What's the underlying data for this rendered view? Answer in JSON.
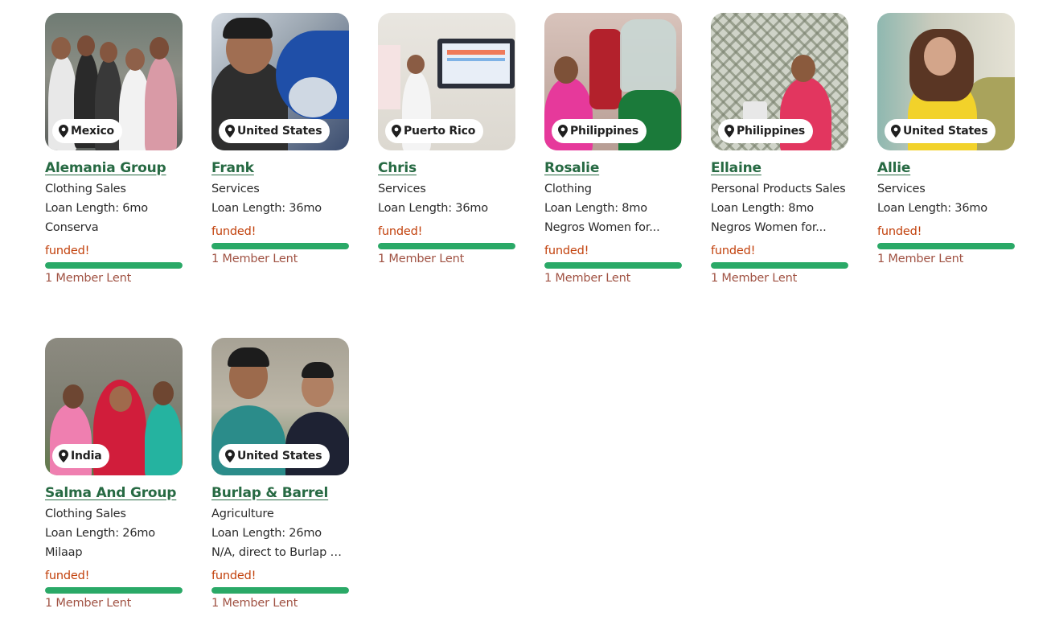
{
  "loans": [
    {
      "name": "Alemania Group",
      "country": "Mexico",
      "sector": "Clothing Sales",
      "loan_length": "Loan Length: 6mo",
      "partner": "Conserva",
      "status": "funded!",
      "progress": 1.0,
      "lenders": "1 Member Lent",
      "icon": "map-pin-icon"
    },
    {
      "name": "Frank",
      "country": "United States",
      "sector": "Services",
      "loan_length": "Loan Length: 36mo",
      "partner": "",
      "status": "funded!",
      "progress": 1.0,
      "lenders": "1 Member Lent",
      "icon": "map-pin-icon"
    },
    {
      "name": "Chris",
      "country": "Puerto Rico",
      "sector": "Services",
      "loan_length": "Loan Length: 36mo",
      "partner": "",
      "status": "funded!",
      "progress": 1.0,
      "lenders": "1 Member Lent",
      "icon": "map-pin-icon"
    },
    {
      "name": "Rosalie",
      "country": "Philippines",
      "sector": "Clothing",
      "loan_length": "Loan Length: 8mo",
      "partner": "Negros Women for...",
      "status": "funded!",
      "progress": 1.0,
      "lenders": "1 Member Lent",
      "icon": "map-pin-icon"
    },
    {
      "name": "Ellaine",
      "country": "Philippines",
      "sector": "Personal Products Sales",
      "loan_length": "Loan Length: 8mo",
      "partner": "Negros Women for...",
      "status": "funded!",
      "progress": 1.0,
      "lenders": "1 Member Lent",
      "icon": "map-pin-icon"
    },
    {
      "name": "Allie",
      "country": "United States",
      "sector": "Services",
      "loan_length": "Loan Length: 36mo",
      "partner": "",
      "status": "funded!",
      "progress": 1.0,
      "lenders": "1 Member Lent",
      "icon": "map-pin-icon"
    },
    {
      "name": "Salma And Group",
      "country": "India",
      "sector": "Clothing Sales",
      "loan_length": "Loan Length: 26mo",
      "partner": "Milaap",
      "status": "funded!",
      "progress": 1.0,
      "lenders": "1 Member Lent",
      "icon": "map-pin-icon"
    },
    {
      "name": "Burlap & Barrel",
      "country": "United States",
      "sector": "Agriculture",
      "loan_length": "Loan Length: 26mo",
      "partner": "N/A, direct to Burlap &...",
      "status": "funded!",
      "progress": 1.0,
      "lenders": "1 Member Lent",
      "icon": "map-pin-icon"
    }
  ],
  "colors": {
    "name_link": "#276a43",
    "funded_text": "#c2410c",
    "progress_fill": "#2aa967",
    "lenders_text": "#a05243"
  }
}
